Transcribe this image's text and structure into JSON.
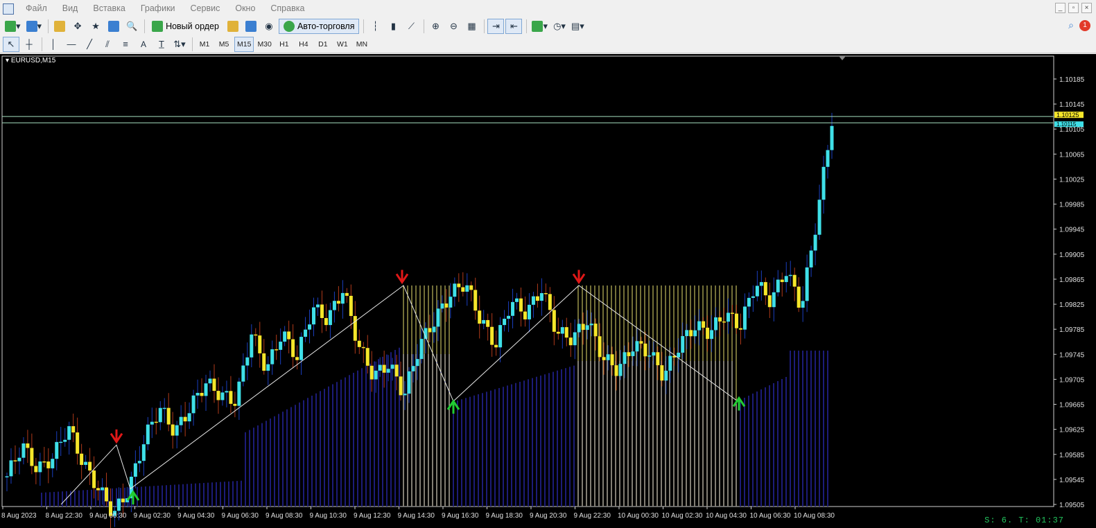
{
  "menu": {
    "items": [
      "Файл",
      "Вид",
      "Вставка",
      "Графики",
      "Сервис",
      "Окно",
      "Справка"
    ]
  },
  "toolbar": {
    "new_order_label": "Новый ордер",
    "autotrade_label": "Авто-торговля",
    "notification_count": "1"
  },
  "timeframes": [
    "M1",
    "M5",
    "M15",
    "M30",
    "H1",
    "H4",
    "D1",
    "W1",
    "MN"
  ],
  "active_timeframe": "M15",
  "chart": {
    "symbol_label": "EURUSD,M15",
    "status_text": "S: 6. T: 01:37",
    "colors": {
      "bull": "#3fe0e8",
      "bear": "#f5e62a",
      "volume": "#1c1c78",
      "zigzag": "#e8e8e8",
      "up_arrow": "#22cc33",
      "down_arrow": "#e01818",
      "vline": "#e8e070",
      "price_line": "#a5e0c0"
    }
  },
  "chart_data": {
    "type": "candlestick",
    "price_axis": [
      "1.10185",
      "1.10145",
      "1.10105",
      "1.10065",
      "1.10025",
      "1.09985",
      "1.09945",
      "1.09905",
      "1.09865",
      "1.09825",
      "1.09785",
      "1.09745",
      "1.09705",
      "1.09665",
      "1.09625",
      "1.09585",
      "1.09545",
      "1.09505"
    ],
    "ylim": [
      1.09505,
      1.10185
    ],
    "price_labels": {
      "bid": "1.10125",
      "ask": "1.10115"
    },
    "time_axis": [
      "8 Aug 2023",
      "8 Aug 22:30",
      "9 Aug 00:30",
      "9 Aug 02:30",
      "9 Aug 04:30",
      "9 Aug 06:30",
      "9 Aug 08:30",
      "9 Aug 10:30",
      "9 Aug 12:30",
      "9 Aug 14:30",
      "9 Aug 16:30",
      "9 Aug 18:30",
      "9 Aug 20:30",
      "9 Aug 22:30",
      "10 Aug 00:30",
      "10 Aug 02:30",
      "10 Aug 04:30",
      "10 Aug 06:30",
      "10 Aug 08:30"
    ],
    "close_path": [
      1.0955,
      1.096,
      1.0956,
      1.0958,
      1.0963,
      1.0957,
      1.0953,
      1.0949,
      1.0953,
      1.0961,
      1.0966,
      1.0962,
      1.0966,
      1.097,
      1.0968,
      1.0967,
      1.0978,
      1.0972,
      1.0978,
      1.0974,
      1.0982,
      1.098,
      1.0985,
      1.0976,
      1.0971,
      1.0973,
      1.0968,
      1.0976,
      1.098,
      1.0984,
      1.0986,
      1.098,
      1.0976,
      1.0983,
      1.0981,
      1.0985,
      1.0978,
      1.0977,
      1.098,
      1.0974,
      1.0972,
      1.0976,
      1.0975,
      1.0971,
      1.0976,
      1.0979,
      1.0978,
      1.0981,
      1.0979,
      1.0986,
      1.0983,
      1.0988,
      1.0982,
      1.0996,
      1.1012
    ],
    "zigzag_prices": [
      1.09505,
      1.096,
      1.0953,
      1.09855,
      1.0967,
      1.09855,
      1.0967
    ],
    "signals": [
      {
        "type": "down",
        "price": 1.09605
      },
      {
        "type": "up",
        "price": 1.09525
      },
      {
        "type": "down",
        "price": 1.0986
      },
      {
        "type": "up",
        "price": 1.0967
      },
      {
        "type": "down",
        "price": 1.0986
      },
      {
        "type": "up",
        "price": 1.09675
      }
    ]
  }
}
